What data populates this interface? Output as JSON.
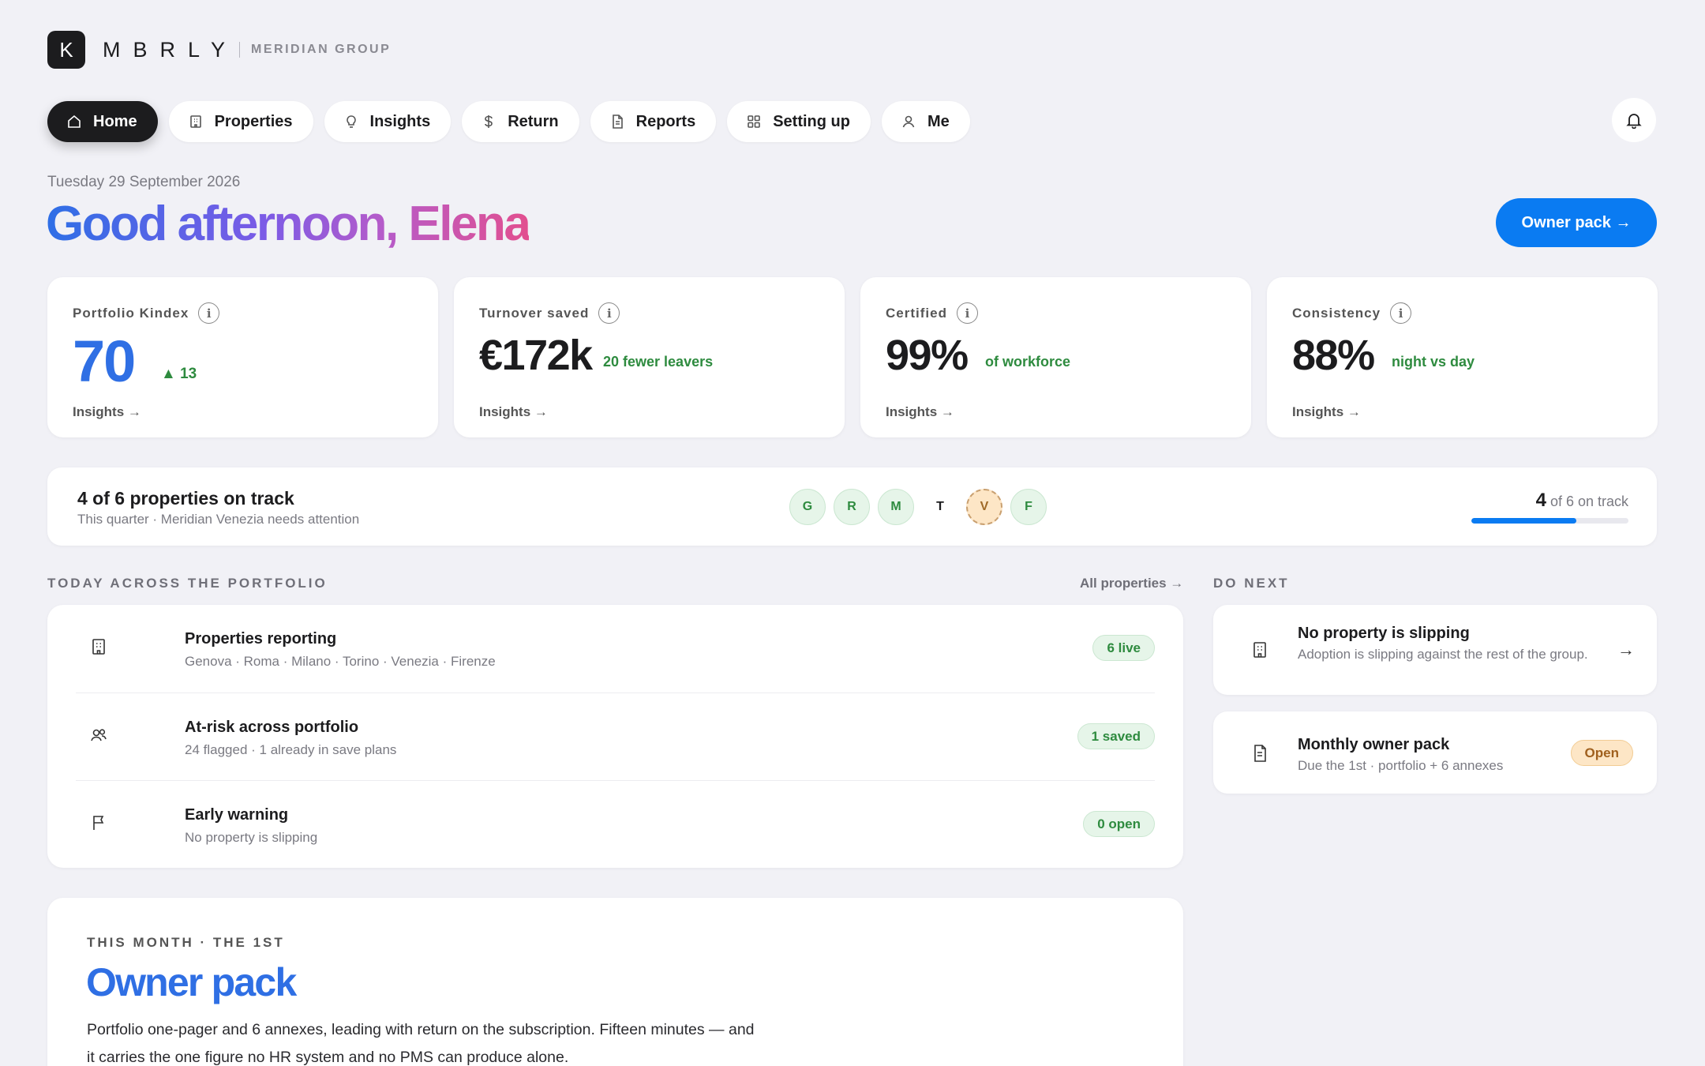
{
  "brand": {
    "logo_letter": "K",
    "wordmark": "MBRLY",
    "org": "MERIDIAN GROUP"
  },
  "nav": {
    "items": [
      {
        "label": "Home",
        "icon": "home-icon"
      },
      {
        "label": "Properties",
        "icon": "building-icon"
      },
      {
        "label": "Insights",
        "icon": "lightbulb-icon"
      },
      {
        "label": "Return",
        "icon": "dollar-icon"
      },
      {
        "label": "Reports",
        "icon": "document-icon"
      },
      {
        "label": "Setting up",
        "icon": "grid-icon"
      },
      {
        "label": "Me",
        "icon": "user-icon"
      }
    ]
  },
  "header": {
    "date": "Tuesday 29 September 2026",
    "greeting": "Good afternoon, Elena",
    "owner_pack_button": "Owner pack →"
  },
  "kpis": [
    {
      "label": "Portfolio Kindex",
      "value": "70",
      "sub": "▲ 13",
      "link": "Insights →"
    },
    {
      "label": "Turnover saved",
      "value": "€172k",
      "sub": "20 fewer leavers",
      "link": "Insights →"
    },
    {
      "label": "Certified",
      "value": "99%",
      "sub": "of workforce",
      "link": "Insights →"
    },
    {
      "label": "Consistency",
      "value": "88%",
      "sub": "night vs day",
      "link": "Insights →"
    }
  ],
  "track": {
    "title": "4 of 6 properties on track",
    "subtitle": "This quarter · Meridian Venezia needs attention",
    "properties": [
      {
        "letter": "G",
        "status": "on-track"
      },
      {
        "letter": "R",
        "status": "on-track"
      },
      {
        "letter": "M",
        "status": "on-track"
      },
      {
        "letter": "T",
        "status": "neutral"
      },
      {
        "letter": "V",
        "status": "attention"
      },
      {
        "letter": "F",
        "status": "on-track"
      }
    ],
    "count": "4",
    "count_suffix": "of 6 on track",
    "progress_fraction": 0.667,
    "progress_color": "#0a7bf2"
  },
  "today": {
    "heading": "TODAY ACROSS THE PORTFOLIO",
    "link": "All properties →",
    "rows": [
      {
        "title": "Properties reporting",
        "sub": "Genova · Roma · Milano · Torino · Venezia · Firenze",
        "badge": "6 live",
        "icon": "building-icon"
      },
      {
        "title": "At-risk across portfolio",
        "sub": "24 flagged · 1 already in save plans",
        "badge": "1 saved",
        "icon": "users-icon"
      },
      {
        "title": "Early warning",
        "sub": "No property is slipping",
        "badge": "0 open",
        "icon": "flag-icon"
      }
    ]
  },
  "do_next": {
    "heading": "DO NEXT",
    "items": [
      {
        "title": "No property is slipping",
        "sub": "Adoption is slipping against the rest of the group.",
        "icon": "building-icon"
      },
      {
        "title": "Monthly owner pack",
        "sub": "Due the 1st · portfolio + 6 annexes",
        "badge": "Open",
        "icon": "document-icon"
      }
    ]
  },
  "owner_pack": {
    "eyebrow": "THIS MONTH · THE 1ST",
    "title": "Owner pack",
    "body": "Portfolio one-pager and 6 annexes, leading with return on the subscription. Fifteen minutes — and it carries the one figure no HR system and no PMS can produce alone."
  },
  "colors": {
    "accent": "#0a7bf2",
    "positive": "#2e8b3f",
    "warning": "#a0601e",
    "kindex": "#2f6fe4"
  }
}
